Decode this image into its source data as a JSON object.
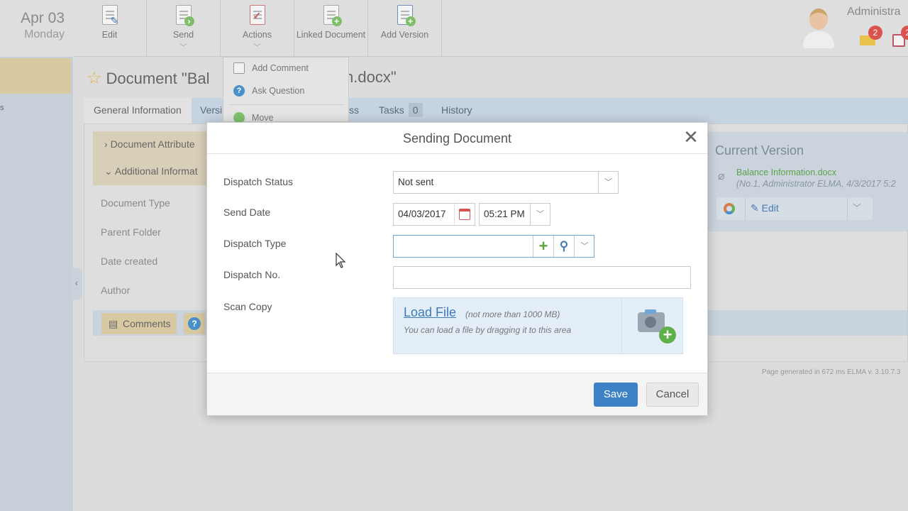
{
  "header": {
    "date": "Apr 03",
    "weekday": "Monday",
    "toolbar": [
      {
        "label": "Edit",
        "icon": "edit-document-icon"
      },
      {
        "label": "Send",
        "icon": "send-document-icon"
      },
      {
        "label": "Actions",
        "icon": "actions-checklist-icon"
      },
      {
        "label": "Linked Document",
        "icon": "linked-document-icon"
      },
      {
        "label": "Add Version",
        "icon": "add-version-icon"
      }
    ],
    "user_name": "Administra",
    "badges": {
      "messages": "2",
      "tasks": "2"
    }
  },
  "document": {
    "title_start": "Document \"Bal",
    "title_end": "n.docx\"",
    "tabs": [
      "General Information",
      "Versi",
      "ss",
      "Tasks",
      "History"
    ],
    "tasks_count": "0",
    "sections": [
      "Document Attribute",
      "Additional Informat"
    ],
    "fields": [
      "Document Type",
      "Parent Folder",
      "Date created",
      "Author"
    ],
    "comments_label": "Comments",
    "page_generated": "Page generated in 672 ms ELMA v. 3.10.7.3"
  },
  "actions_menu": {
    "items": [
      "Add Comment",
      "Ask Question",
      "Move"
    ]
  },
  "current_version": {
    "title": "Current Version",
    "file_name": "Balance Information.docx",
    "meta": "(No.1, Administrator ELMA, 4/3/2017 5:2",
    "edit_label": "Edit"
  },
  "dialog": {
    "title": "Sending Document",
    "fields": {
      "status_label": "Dispatch Status",
      "status_value": "Not sent",
      "send_date_label": "Send Date",
      "date_value": "04/03/2017",
      "time_value": "05:21 PM",
      "type_label": "Dispatch Type",
      "type_value": "",
      "number_label": "Dispatch No.",
      "number_value": "",
      "scan_label": "Scan Copy"
    },
    "scan": {
      "link": "Load File",
      "limit": "(not more than 1000 MB)",
      "hint": "You can load a file by dragging it to this area"
    },
    "buttons": {
      "save": "Save",
      "cancel": "Cancel"
    }
  },
  "colors": {
    "primary": "#3d82c6",
    "add_green": "#5aa83c",
    "badge_red": "#d9534f",
    "link_blue": "#3c7ab8"
  }
}
